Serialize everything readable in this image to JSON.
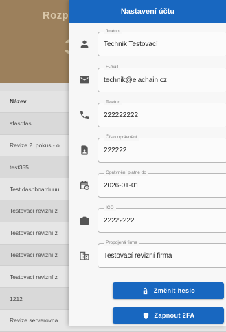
{
  "background": {
    "title": "Rozpra",
    "big_number": "3",
    "table": {
      "header": "Název",
      "rows": [
        "sfasdfas",
        "Revize 2. pokus - o",
        "test355",
        "Test dashboarduuu",
        "Testovací revizní z",
        "Testovací revizní z",
        "Testovací revizní z",
        "Testovací revizní z",
        "1212",
        "Revize serverovna"
      ]
    }
  },
  "drawer": {
    "title": "Nastavení účtu",
    "fields": [
      {
        "label": "Jméno",
        "value": "Technik Testovací",
        "icon": "person-icon"
      },
      {
        "label": "E-mail",
        "value": "technik@elachain.cz",
        "icon": "email-icon"
      },
      {
        "label": "Telefon",
        "value": "222222222",
        "icon": "phone-icon"
      },
      {
        "label": "Číslo oprávnění",
        "value": "222222",
        "icon": "badge-icon"
      },
      {
        "label": "Oprávnění platné do",
        "value": "2026-01-01",
        "icon": "calendar-clock-icon"
      },
      {
        "label": "IČO",
        "value": "22222222",
        "icon": "briefcase-icon"
      },
      {
        "label": "Propojená firma",
        "value": "Testovací revizní firma",
        "icon": "building-icon"
      }
    ],
    "buttons": {
      "change_password": "Změnit heslo",
      "enable_2fa": "Zapnout 2FA"
    }
  },
  "colors": {
    "primary": "#1867c0",
    "background_header": "#9c805c"
  }
}
